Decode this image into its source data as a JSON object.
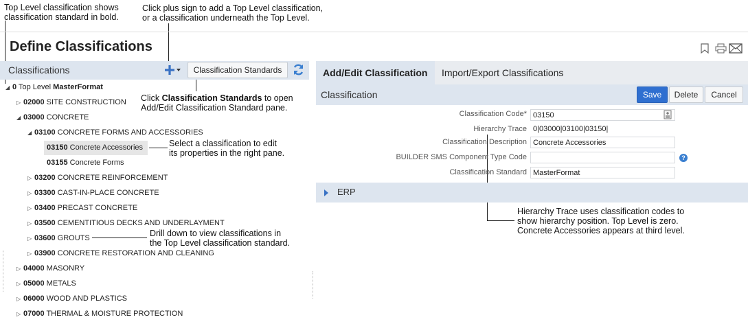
{
  "annotations": {
    "top_level": [
      "Top Level classification shows",
      "classification standard in bold."
    ],
    "plus": [
      "Click plus sign to add a Top Level classification,",
      "or a classification underneath the Top Level."
    ],
    "standards_prefix": "Click ",
    "standards_bold": "Classification Standards",
    "standards_suffix": " to open",
    "standards_line2": "Add/Edit Classification Standard pane.",
    "select": [
      "Select a classification to edit",
      "its properties in the right pane."
    ],
    "drill": [
      "Drill down to view classifications in",
      "the Top Level classification standard."
    ],
    "trace": [
      "Hierarchy Trace uses classification codes to",
      "show hierarchy position. Top Level is zero.",
      "Concrete Accessories appears at third level."
    ]
  },
  "page": {
    "title": "Define Classifications"
  },
  "left": {
    "header": "Classifications",
    "standards_button": "Classification Standards"
  },
  "tree": [
    {
      "code": "0",
      "prefix": "Top Level ",
      "name": "MasterFormat",
      "caret": "◢"
    },
    {
      "code": "02000",
      "name": " SITE CONSTRUCTION",
      "caret": "▷"
    },
    {
      "code": "03000",
      "name": " CONCRETE",
      "caret": "◢"
    },
    {
      "code": "03100",
      "name": " CONCRETE FORMS AND ACCESSORIES",
      "caret": "◢"
    },
    {
      "code": "03150",
      "name": " Concrete Accessories",
      "caret": ""
    },
    {
      "code": "03155",
      "name": " Concrete Forms",
      "caret": ""
    },
    {
      "code": "03200",
      "name": " CONCRETE REINFORCEMENT",
      "caret": "▷"
    },
    {
      "code": "03300",
      "name": " CAST-IN-PLACE CONCRETE",
      "caret": "▷"
    },
    {
      "code": "03400",
      "name": " PRECAST CONCRETE",
      "caret": "▷"
    },
    {
      "code": "03500",
      "name": " CEMENTITIOUS DECKS AND UNDERLAYMENT",
      "caret": "▷"
    },
    {
      "code": "03600",
      "name": " GROUTS",
      "caret": "▷"
    },
    {
      "code": "03900",
      "name": " CONCRETE RESTORATION AND CLEANING",
      "caret": "▷"
    },
    {
      "code": "04000",
      "name": " MASONRY",
      "caret": "▷"
    },
    {
      "code": "05000",
      "name": " METALS",
      "caret": "▷"
    },
    {
      "code": "06000",
      "name": " WOOD AND PLASTICS",
      "caret": "▷"
    },
    {
      "code": "07000",
      "name": " THERMAL & MOISTURE PROTECTION",
      "caret": "▷"
    }
  ],
  "tabs": [
    "Add/Edit Classification",
    "Import/Export Classifications"
  ],
  "form": {
    "section": "Classification",
    "save": "Save",
    "delete": "Delete",
    "cancel": "Cancel",
    "code_label": "Classification Code*",
    "code_value": "03150",
    "trace_label": "Hierarchy Trace",
    "trace_value": "0|03000|03100|03150|",
    "desc_label": "Classification Description",
    "desc_value": "Concrete Accessories",
    "sms_label": "BUILDER SMS Component Type Code",
    "sms_value": "",
    "std_label": "Classification Standard",
    "std_value": "MasterFormat"
  },
  "erp": {
    "label": "ERP"
  },
  "colors": {
    "accent": "#2f6fd0",
    "pane_header": "#dde5ef"
  }
}
